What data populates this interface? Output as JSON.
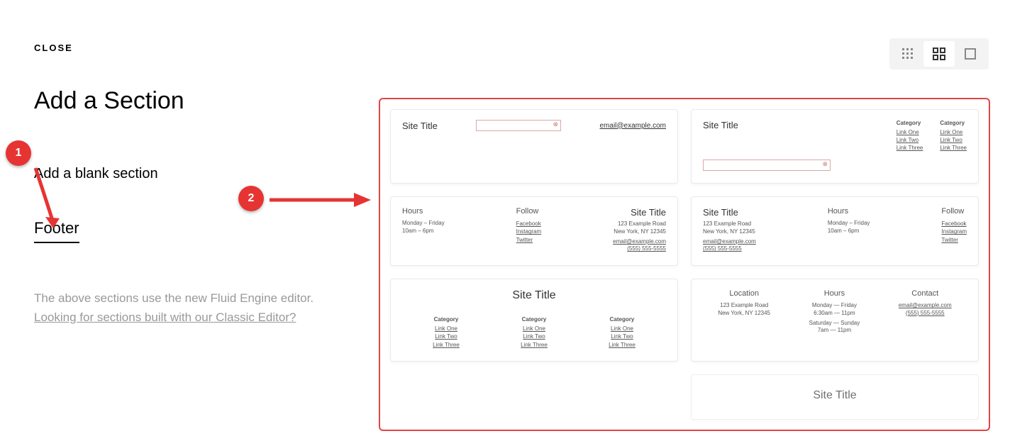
{
  "close_label": "CLOSE",
  "page_title": "Add a Section",
  "blank_section_label": "Add a blank section",
  "footer_label": "Footer",
  "note_text_1": "The above sections use the new Fluid Engine editor. ",
  "note_link": "Looking for sections built with our Classic Editor?",
  "annotations": {
    "a1": "1",
    "a2": "2"
  },
  "templates": {
    "t1": {
      "site_title": "Site Title",
      "email": "email@example.com"
    },
    "t2": {
      "site_title": "Site Title",
      "cat1": {
        "hdr": "Category",
        "l1": "Link One",
        "l2": "Link Two",
        "l3": "Link Three"
      },
      "cat2": {
        "hdr": "Category",
        "l1": "Link One",
        "l2": "Link Two",
        "l3": "Link Three"
      }
    },
    "t3": {
      "hours_hdr": "Hours",
      "hours_line1": "Monday – Friday",
      "hours_line2": "10am – 6pm",
      "follow_hdr": "Follow",
      "f1": "Facebook",
      "f2": "Instagram",
      "f3": "Twitter",
      "site_title": "Site Title",
      "addr1": "123 Example Road",
      "addr2": "New York, NY 12345",
      "email": "email@example.com",
      "phone": "(555) 555-5555"
    },
    "t4": {
      "site_title": "Site Title",
      "addr1": "123 Example Road",
      "addr2": "New York, NY 12345",
      "email": "email@example.com",
      "phone": "(555) 555-5555",
      "hours_hdr": "Hours",
      "hours_line1": "Monday – Friday",
      "hours_line2": "10am – 6pm",
      "follow_hdr": "Follow",
      "f1": "Facebook",
      "f2": "Instagram",
      "f3": "Twitter"
    },
    "t5": {
      "site_title": "Site Title",
      "cat1": {
        "hdr": "Category",
        "l1": "Link One",
        "l2": "Link Two",
        "l3": "Link Three"
      },
      "cat2": {
        "hdr": "Category",
        "l1": "Link One",
        "l2": "Link Two",
        "l3": "Link Three"
      },
      "cat3": {
        "hdr": "Category",
        "l1": "Link One",
        "l2": "Link Two",
        "l3": "Link Three"
      }
    },
    "t6": {
      "loc_hdr": "Location",
      "addr1": "123 Example Road",
      "addr2": "New York, NY 12345",
      "hours_hdr": "Hours",
      "h1a": "Monday — Friday",
      "h1b": "6:30am — 11pm",
      "h2a": "Saturday — Sunday",
      "h2b": "7am — 11pm",
      "contact_hdr": "Contact",
      "email": "email@example.com",
      "phone": "(555) 555-5555"
    },
    "t7": {
      "site_title": "Site Title"
    }
  }
}
